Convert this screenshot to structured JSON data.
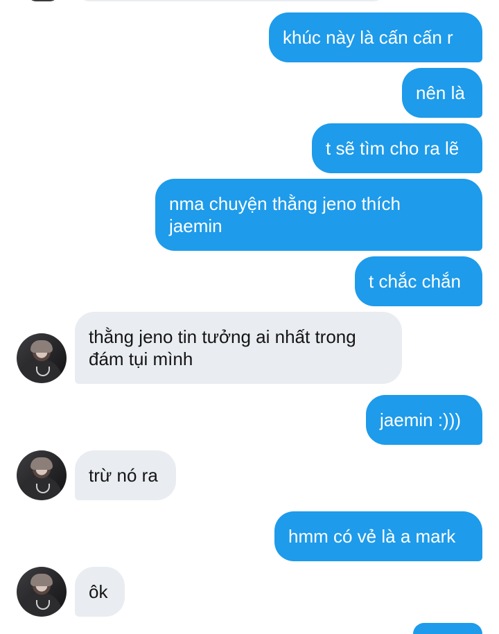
{
  "messages": [
    {
      "id": "m1",
      "side": "out",
      "lines": [
        "khúc này là cấn cấn r"
      ]
    },
    {
      "id": "m2",
      "side": "out",
      "lines": [
        "nên là"
      ]
    },
    {
      "id": "m3",
      "side": "out",
      "lines": [
        "t sẽ tìm cho ra lẽ"
      ]
    },
    {
      "id": "m4",
      "side": "out",
      "lines": [
        "nma chuyện thằng jeno thích",
        "jaemin"
      ]
    },
    {
      "id": "m5",
      "side": "out",
      "lines": [
        "t chắc chắn"
      ]
    },
    {
      "id": "m6",
      "side": "in",
      "lines": [
        "thằng jeno tin tưởng ai nhất trong",
        "đám tụi mình"
      ]
    },
    {
      "id": "m7",
      "side": "out",
      "lines": [
        "jaemin :)))"
      ]
    },
    {
      "id": "m8",
      "side": "in",
      "lines": [
        "trừ nó ra"
      ]
    },
    {
      "id": "m9",
      "side": "out",
      "lines": [
        "hmm có vẻ là a mark"
      ]
    },
    {
      "id": "m10",
      "side": "in",
      "lines": [
        "ôk"
      ]
    }
  ],
  "colors": {
    "outgoing_bubble": "#1e9bea",
    "incoming_bubble": "#e9ecf0",
    "outgoing_text": "#ffffff",
    "incoming_text": "#141414"
  }
}
